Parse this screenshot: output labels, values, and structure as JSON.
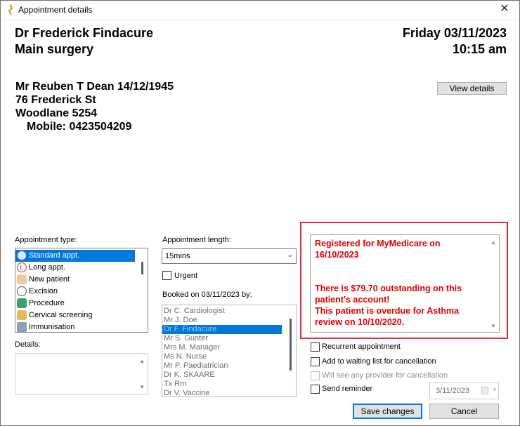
{
  "window": {
    "title": "Appointment details",
    "close_glyph": "✕"
  },
  "header": {
    "doctor": "Dr Frederick Findacure",
    "location": "Main surgery",
    "date": "Friday 03/11/2023",
    "time": "10:15 am"
  },
  "patient": {
    "name_dob": "Mr Reuben T Dean  14/12/1945",
    "street": "76 Frederick St",
    "suburb": "Woodlane  5254",
    "mobile": "Mobile: 0423504209"
  },
  "buttons": {
    "view_details": "View details",
    "save": "Save changes",
    "cancel": "Cancel"
  },
  "appointment_type": {
    "label": "Appointment type:",
    "items": [
      {
        "label": "Standard appt.",
        "icon": "clock-icon",
        "selected": true
      },
      {
        "label": "Long appt.",
        "icon": "long-appt-icon",
        "selected": false
      },
      {
        "label": "New patient",
        "icon": "new-patient-icon",
        "selected": false
      },
      {
        "label": "Excision",
        "icon": "clock-icon",
        "selected": false
      },
      {
        "label": "Procedure",
        "icon": "procedure-icon",
        "selected": false
      },
      {
        "label": "Cervical screening",
        "icon": "person-icon",
        "selected": false
      },
      {
        "label": "Immunisation",
        "icon": "syringe-icon",
        "selected": false
      }
    ]
  },
  "appointment_length": {
    "label": "Appointment length:",
    "value": "15mins"
  },
  "urgent": {
    "label": "Urgent",
    "checked": false
  },
  "booked_on": {
    "label": "Booked on 03/11/2023 by:",
    "items": [
      {
        "label": "Dr C. Cardiologist",
        "selected": false
      },
      {
        "label": "Mr J. Doe",
        "selected": false
      },
      {
        "label": "Dr F. Findacure",
        "selected": true
      },
      {
        "label": "Mr S. Gunter",
        "selected": false
      },
      {
        "label": "Mrs M. Manager",
        "selected": false
      },
      {
        "label": "Ms N. Nurse",
        "selected": false
      },
      {
        "label": "Mr P. Paediatrician",
        "selected": false
      },
      {
        "label": "Dr K. SKAARE",
        "selected": false
      },
      {
        "label": "Tx Rm",
        "selected": false
      },
      {
        "label": "Dr V. Vaccine",
        "selected": false
      }
    ]
  },
  "alert": {
    "line1": "Registered for MyMedicare on 16/10/2023",
    "line2": "There is $79.70 outstanding on this patient's account!",
    "line3": "This patient is overdue for Asthma review on 10/10/2020."
  },
  "details": {
    "label": "Details:",
    "value": ""
  },
  "options": {
    "recurrent": "Recurrent appointment",
    "waiting_list": "Add to waiting list for cancellation",
    "any_provider": "Will see any provider for cancellation",
    "send_reminder": "Send reminder"
  },
  "reminder_date": "3/11/2023",
  "colors": {
    "accent": "#0078d7",
    "alert_text": "#e00000",
    "alert_border": "#e03030"
  }
}
